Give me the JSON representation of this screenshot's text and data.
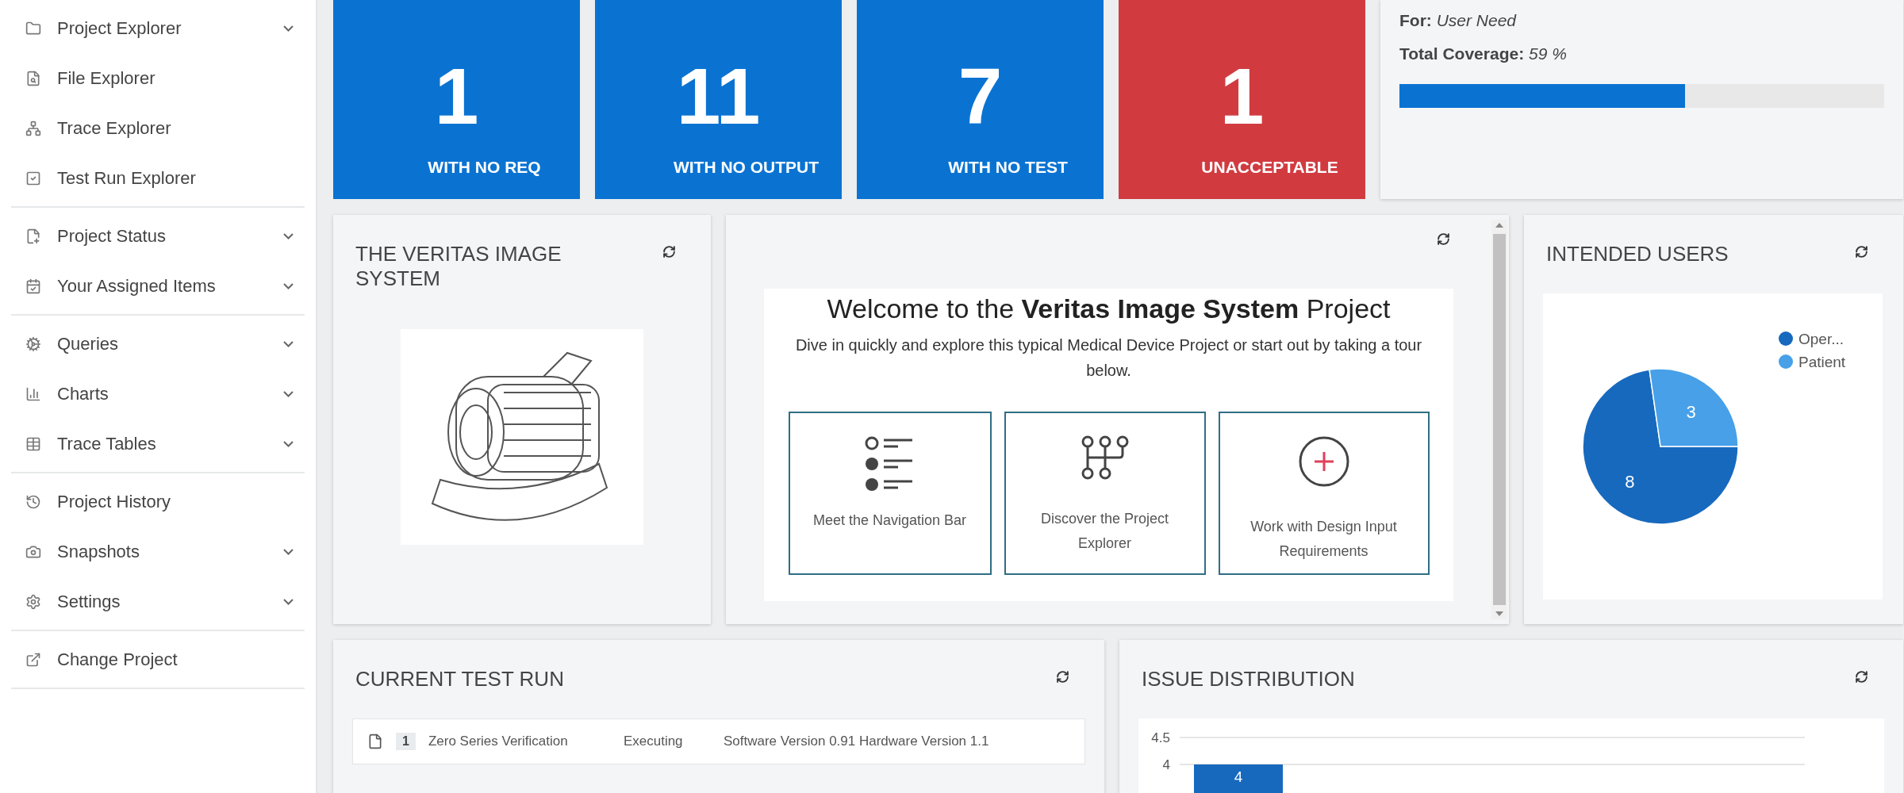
{
  "sidebar": {
    "groups": [
      {
        "items": [
          {
            "label": "Project Explorer",
            "has_submenu": true
          },
          {
            "label": "File Explorer",
            "has_submenu": false
          },
          {
            "label": "Trace Explorer",
            "has_submenu": false
          },
          {
            "label": "Test Run Explorer",
            "has_submenu": false
          }
        ]
      },
      {
        "items": [
          {
            "label": "Project Status",
            "has_submenu": true
          },
          {
            "label": "Your Assigned Items",
            "has_submenu": true
          }
        ]
      },
      {
        "items": [
          {
            "label": "Queries",
            "has_submenu": true
          },
          {
            "label": "Charts",
            "has_submenu": true
          },
          {
            "label": "Trace Tables",
            "has_submenu": true
          }
        ]
      },
      {
        "items": [
          {
            "label": "Project History",
            "has_submenu": false
          },
          {
            "label": "Snapshots",
            "has_submenu": true
          },
          {
            "label": "Settings",
            "has_submenu": true
          }
        ]
      },
      {
        "items": [
          {
            "label": "Change Project",
            "has_submenu": false
          }
        ]
      }
    ]
  },
  "tiles": [
    {
      "value": "1",
      "label": "WITH NO REQ",
      "color": "#0a73d2"
    },
    {
      "value": "11",
      "label": "WITH NO OUTPUT",
      "color": "#0a73d2"
    },
    {
      "value": "7",
      "label": "WITH NO TEST",
      "color": "#0a73d2"
    },
    {
      "value": "1",
      "label": "UNACCEPTABLE",
      "color": "#d13b40"
    }
  ],
  "coverage": {
    "for_label": "For:",
    "for_value": "User Need",
    "total_label": "Total Coverage:",
    "total_value": "59 %",
    "level": 0.59
  },
  "product_card": {
    "title": "THE VERITAS IMAGE SYSTEM"
  },
  "welcome_card": {
    "heading": "Welcome to the **Veritas Image System** Project",
    "intro": "Dive in quickly and explore this typical Medical Device Project or start out by taking a tour below.",
    "tours": [
      {
        "kind": "list",
        "label": "Meet the Navigation Bar"
      },
      {
        "kind": "tree",
        "label": "Discover the Project Explorer"
      },
      {
        "kind": "add",
        "label": "Work with Design Input Requirements"
      }
    ]
  },
  "intended_users": {
    "title": "INTENDED USERS",
    "chart_data": {
      "type": "pie",
      "categories": [
        "Oper...",
        "Patient"
      ],
      "values": [
        8,
        3
      ],
      "colors": [
        "#1769be",
        "#47a0e8"
      ],
      "data_labels": true,
      "legend": "top-right"
    }
  },
  "current_test_run": {
    "title": "CURRENT TEST RUN",
    "runs": [
      {
        "number": "1",
        "name": "Zero Series Verification",
        "status": "Executing",
        "version": "Software Version 0.91 Hardware Version 1.1"
      }
    ]
  },
  "issue_distribution": {
    "title": "ISSUE DISTRIBUTION",
    "chart_data": {
      "type": "bar",
      "values": [
        4
      ],
      "yticks": [
        4,
        4.5
      ],
      "ylim": [
        0,
        4.5
      ],
      "data_labels": true
    }
  }
}
